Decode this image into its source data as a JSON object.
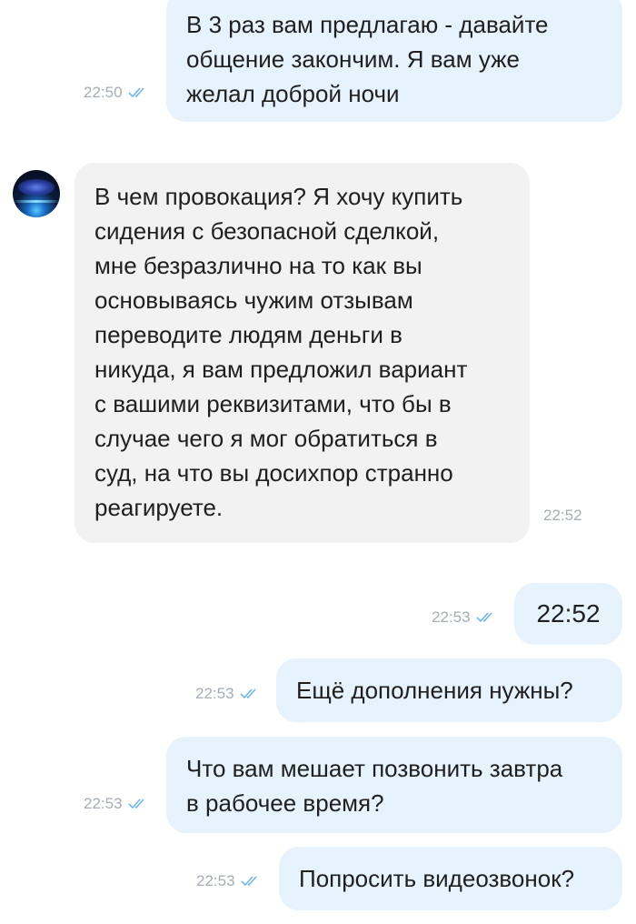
{
  "colors": {
    "outgoing_bubble": "#e6f3fd",
    "incoming_bubble": "#f2f2f2",
    "read_checks": "#6fb6ea",
    "timestamp": "#a5adb5"
  },
  "messages": [
    {
      "direction": "outgoing",
      "text": "В 3 раз вам предлагаю - давайте\nобщение закончим. Я вам уже\nжелал доброй ночи",
      "time": "22:50",
      "status_icon": "double-check-icon"
    },
    {
      "direction": "incoming",
      "avatar_icon": "avatar-image",
      "text": "В чем провокация? Я хочу купить\nсидения с безопасной сделкой,\nмне безразлично на то как вы\nосновываясь чужим отзывам\nпереводите людям деньги в\nникуда, я вам предложил вариант\nс вашими реквизитами, что бы в\nслучае чего я мог обратиться в\nсуд, на что вы досихпор странно\nреагируете.",
      "time": "22:52"
    },
    {
      "direction": "outgoing",
      "text": "22:52",
      "time": "22:53",
      "status_icon": "double-check-icon"
    },
    {
      "direction": "outgoing",
      "text": "Ещё дополнения нужны?",
      "time": "22:53",
      "status_icon": "double-check-icon"
    },
    {
      "direction": "outgoing",
      "text": "Что вам мешает позвонить завтра\nв рабочее время?",
      "time": "22:53",
      "status_icon": "double-check-icon"
    },
    {
      "direction": "outgoing",
      "text": "Попросить видеозвонок?",
      "time": "22:53",
      "status_icon": "double-check-icon"
    }
  ]
}
